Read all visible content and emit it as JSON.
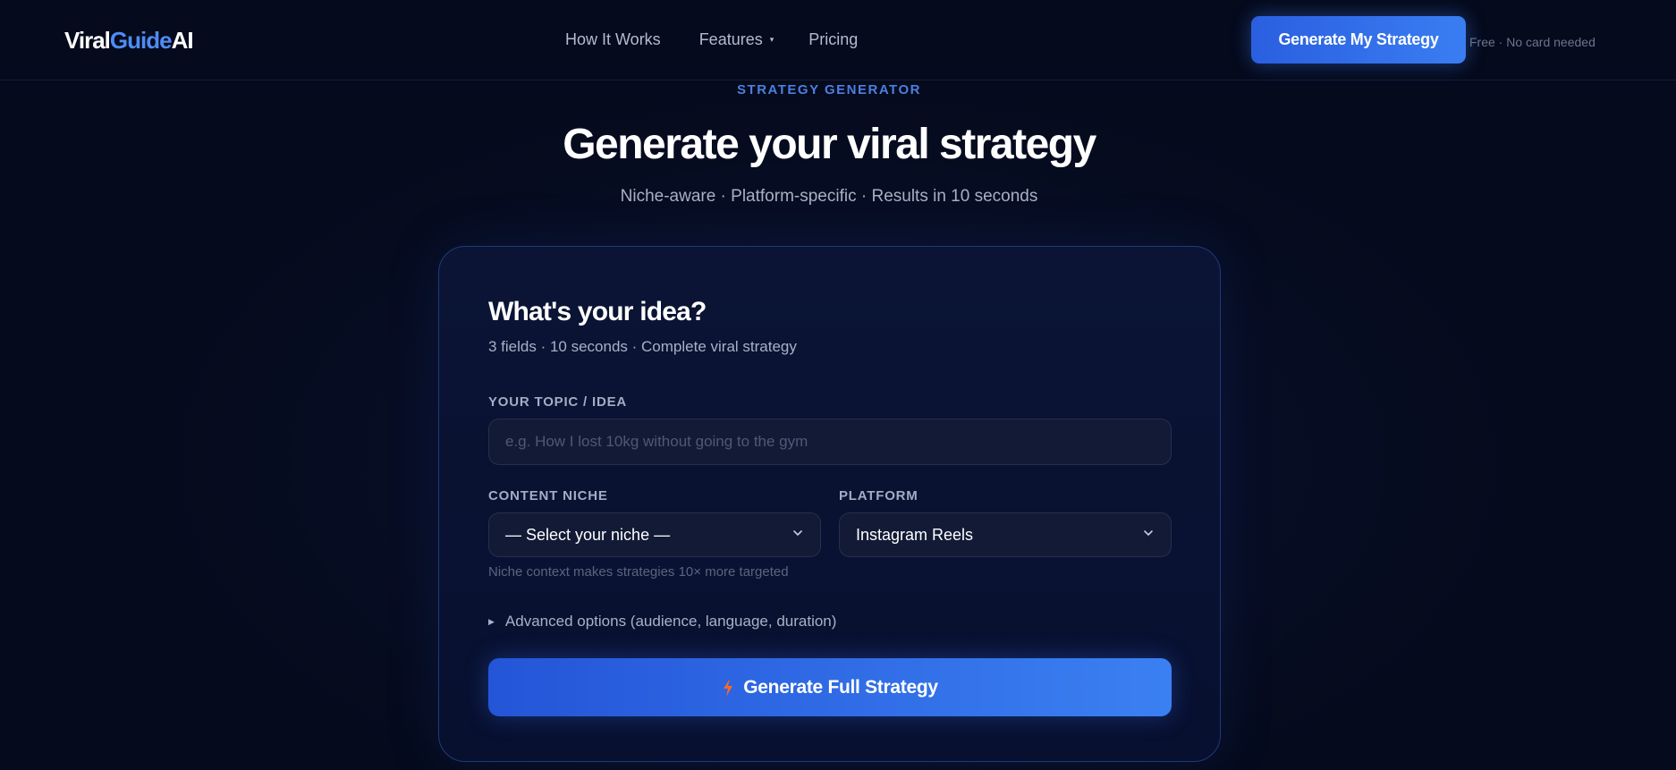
{
  "nav": {
    "logo": {
      "part1": "Viral",
      "part2": "Guide",
      "part3": "AI"
    },
    "links": [
      {
        "label": "How It Works"
      },
      {
        "label": "Features"
      },
      {
        "label": "Pricing"
      }
    ],
    "cta_label": "Generate My Strategy",
    "cta_note": "Free · No card needed"
  },
  "hero": {
    "eyebrow": "STRATEGY GENERATOR",
    "title": "Generate your viral strategy",
    "subtitle": "Niche-aware · Platform-specific · Results in 10 seconds"
  },
  "form": {
    "title": "What's your idea?",
    "subtitle": "3 fields · 10 seconds · Complete viral strategy",
    "topic_label": "YOUR TOPIC / IDEA",
    "topic_placeholder": "e.g. How I lost 10kg without going to the gym",
    "topic_value": "",
    "niche_label": "CONTENT NICHE",
    "niche_selected": "— Select your niche —",
    "niche_hint": "Niche context makes strategies 10× more targeted",
    "platform_label": "PLATFORM",
    "platform_selected": "Instagram Reels",
    "advanced_label": "Advanced options (audience, language, duration)",
    "submit_label": "Generate Full Strategy"
  },
  "colors": {
    "background": "#050a1c",
    "accent": "#3b7ff2",
    "bolt": "#f26b2c"
  },
  "icons": {
    "features_caret": "caret-down-icon",
    "select_chevron": "chevron-down-icon",
    "advanced_toggle": "triangle-right-icon",
    "submit_icon": "lightning-bolt-icon"
  }
}
